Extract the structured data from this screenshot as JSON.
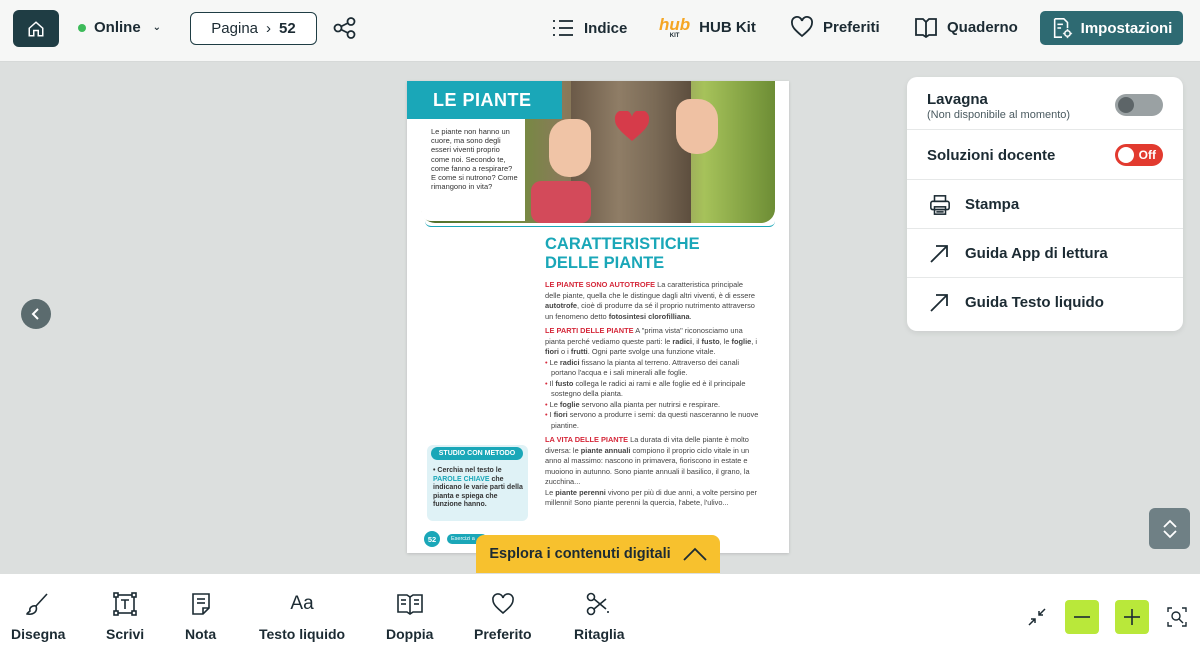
{
  "topbar": {
    "status_label": "Online",
    "page_label": "Pagina",
    "page_number": "52",
    "nav": {
      "index_label": "Indice",
      "hubkit_logo": "hub",
      "hubkit_logo_sub": "KIT",
      "hubkit_label": "HUB Kit",
      "favorites_label": "Preferiti",
      "notebook_label": "Quaderno",
      "settings_label": "Impostazioni"
    },
    "colors": {
      "accent": "#2e6a72",
      "home": "#1f3d44",
      "online": "#3dbb5a"
    }
  },
  "book_page": {
    "title": "LE PIANTE",
    "intro": "Le piante non hanno un cuore, ma sono degli esseri viventi proprio come noi. Secondo te, come fanno a respirare? E come si nutrono? Come rimangono in vita?",
    "section_title_1": "CARATTERISTICHE",
    "section_title_2": "DELLE PIANTE",
    "p1_head": "LE PIANTE SONO AUTOTROFE",
    "p1_a": " La caratteristica principale delle piante, quella che le distingue dagli altri viventi, è di essere ",
    "p1_b": "autotrofe",
    "p1_c": ", cioè di produrre da sé il proprio nutrimento attraverso un fenomeno detto ",
    "p1_d": "fotosintesi clorofilliana",
    "p1_e": ".",
    "p2_head": "LE PARTI DELLE PIANTE",
    "p2_a": " A \"prima vista\" riconosciamo una pianta perché vediamo queste parti: le ",
    "p2_b": "radici",
    "p2_c": ", il ",
    "p2_d": "fusto",
    "p2_e": ", le ",
    "p2_f": "foglie",
    "p2_g": ", i ",
    "p2_h": "fiori",
    "p2_i": " o i ",
    "p2_j": "frutti",
    "p2_k": ". Ogni parte svolge una funzione vitale.",
    "bullets": [
      {
        "pre": "Le ",
        "bold": "radici",
        "post": " fissano la pianta al terreno. Attraverso dei canali portano l'acqua e i sali minerali alle foglie."
      },
      {
        "pre": "Il ",
        "bold": "fusto",
        "post": " collega le radici ai rami e alle foglie ed è il principale sostegno della pianta."
      },
      {
        "pre": "Le ",
        "bold": "foglie",
        "post": " servono alla pianta per nutrirsi e respirare."
      },
      {
        "pre": "I ",
        "bold": "fiori",
        "post": " servono a produrre i semi: da questi nasceranno le nuove piantine."
      }
    ],
    "p3_head": "LA VITA DELLE PIANTE",
    "p3_a": " La durata di vita delle piante è molto diversa: le ",
    "p3_b": "piante annuali",
    "p3_c": " compiono il proprio ciclo vitale in un anno al massimo: nascono in primavera, fioriscono in estate e muoiono in autunno. Sono piante annuali il basilico, il grano, la zucchina...",
    "p4_a": "Le ",
    "p4_b": "piante perenni",
    "p4_c": " vivono per più di due anni, a volte persino per millenni! Sono piante perenni la quercia, l'abete, l'ulivo...",
    "studio_head": "STUDIO CON METODO",
    "studio_a": "• Cerchia nel testo le ",
    "studio_kw": "PAROLE CHIAVE",
    "studio_b": " che indicano le varie parti della pianta e spiega che funzione hanno.",
    "page_num": "52",
    "esercizi": "Esercizi a pag."
  },
  "digital_tab_label": "Esplora i contenuti digitali",
  "panel": {
    "lavagna_label": "Lavagna",
    "lavagna_sub": "(Non disponibile al momento)",
    "lavagna_state": "off-disabled",
    "solutions_label": "Soluzioni docente",
    "solutions_toggle": "Off",
    "print_label": "Stampa",
    "guide_app_label": "Guida App di lettura",
    "guide_text_label": "Guida Testo liquido"
  },
  "bottombar": {
    "tools": {
      "draw": "Disegna",
      "write": "Scrivi",
      "note": "Nota",
      "liquid_text": "Testo liquido",
      "liquid_text_glyph": "Aa",
      "double": "Doppia",
      "favorite": "Preferito",
      "crop": "Ritaglia"
    },
    "zoom_color": "#b9e83a"
  }
}
